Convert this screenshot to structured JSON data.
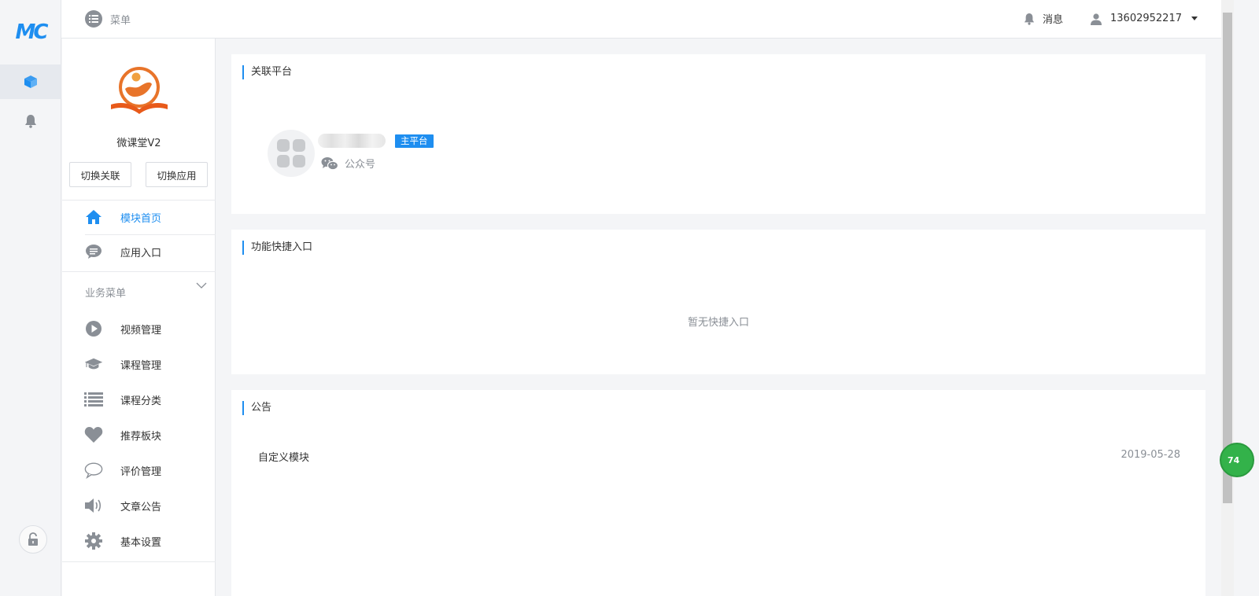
{
  "rail": {
    "logo": "MC",
    "items": [
      {
        "icon": "cube-icon",
        "active": true
      },
      {
        "icon": "bell-icon",
        "active": false
      }
    ],
    "bottom_icon": "lock-icon"
  },
  "header": {
    "menu_label": "菜单",
    "messages_label": "消息",
    "user_phone": "13602952217"
  },
  "sidebar": {
    "app_name": "微课堂V2",
    "switch_link_button": "切换关联",
    "switch_app_button": "切换应用",
    "top_items": [
      {
        "label": "模块首页",
        "icon": "home-icon",
        "active": true
      },
      {
        "label": "应用入口",
        "icon": "chat-bubble-icon",
        "active": false
      }
    ],
    "group_title": "业务菜单",
    "group_items": [
      {
        "label": "视频管理",
        "icon": "play-circle-icon"
      },
      {
        "label": "课程管理",
        "icon": "graduation-cap-icon"
      },
      {
        "label": "课程分类",
        "icon": "list-icon"
      },
      {
        "label": "推荐板块",
        "icon": "heart-icon"
      },
      {
        "label": "评价管理",
        "icon": "comment-icon"
      },
      {
        "label": "文章公告",
        "icon": "speaker-icon"
      },
      {
        "label": "基本设置",
        "icon": "gear-icon"
      }
    ]
  },
  "main": {
    "linked_platform": {
      "title": "关联平台",
      "badge": "主平台",
      "account_type": "公众号",
      "account_icon": "wechat-icon"
    },
    "quick_entry": {
      "title": "功能快捷入口",
      "empty_text": "暂无快捷入口"
    },
    "notice": {
      "title": "公告",
      "items": [
        {
          "title": "自定义模块",
          "date": "2019-05-28"
        }
      ]
    }
  },
  "floating_widget": {
    "text": "74"
  },
  "colors": {
    "accent": "#1e8ef0",
    "muted": "#8a8f96",
    "logo_orange": "#e8742a",
    "widget_green": "#33b24a"
  }
}
